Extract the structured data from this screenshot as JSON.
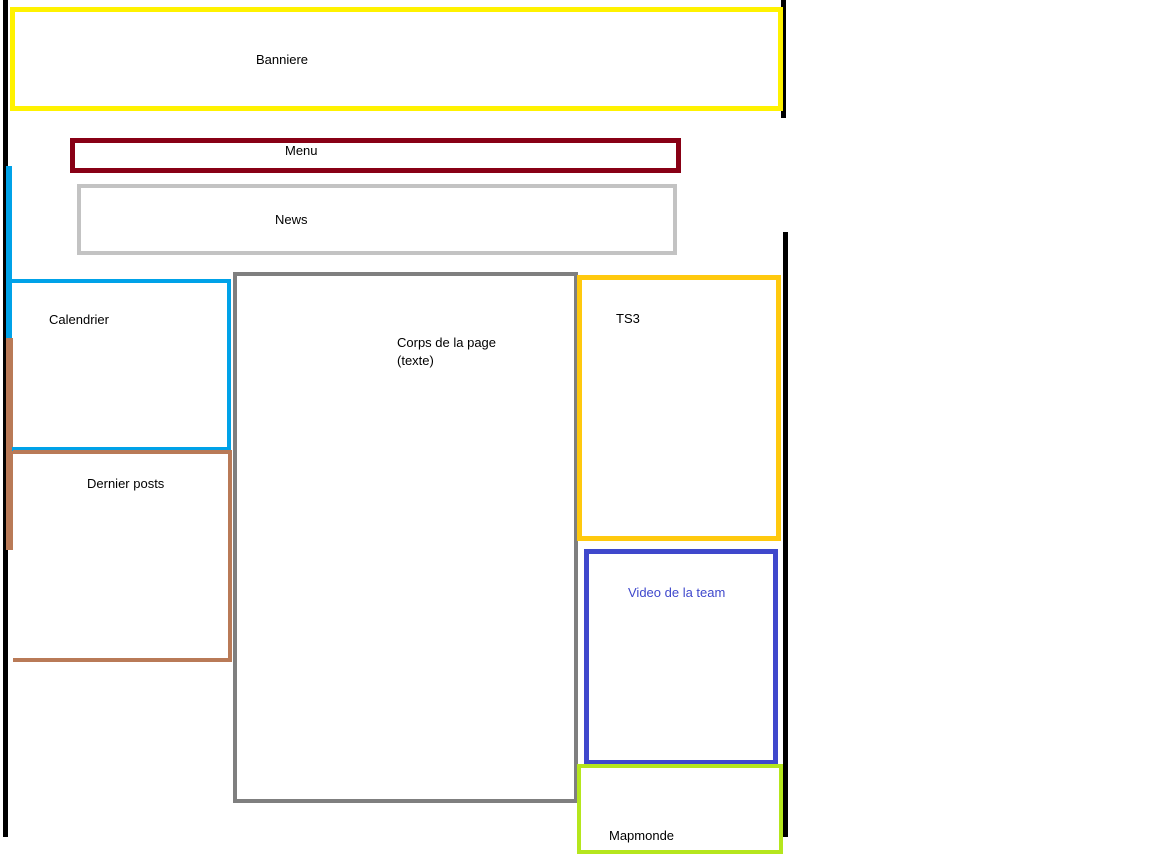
{
  "colors": {
    "banner": "#fff200",
    "menu": "#880015",
    "news": "#c3c3c3",
    "calendar": "#00a2e8",
    "posts": "#b97a57",
    "body": "#7f7f7f",
    "ts3": "#ffc90e",
    "video": "#3f48cc",
    "mapmonde": "#b5e61d",
    "guide_lines": "#000000"
  },
  "sections": {
    "banner": "Banniere",
    "menu": "Menu",
    "news": "News",
    "calendar": "Calendrier",
    "posts": "Dernier posts",
    "body": "Corps de la page\n(texte)",
    "ts3": "TS3",
    "video": "Video de la team",
    "mapmonde": "Mapmonde"
  }
}
